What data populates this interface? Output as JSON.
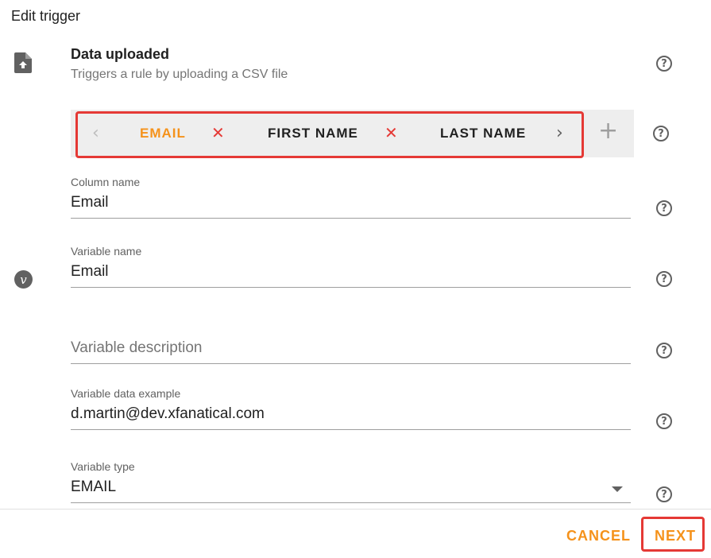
{
  "dialog": {
    "title": "Edit trigger"
  },
  "trigger": {
    "icon": "file-upload-icon",
    "title": "Data uploaded",
    "description": "Triggers a rule by uploading a CSV file"
  },
  "tabs": {
    "items": [
      {
        "label": "EMAIL",
        "active": true
      },
      {
        "label": "FIRST NAME",
        "active": false
      },
      {
        "label": "LAST NAME",
        "active": false
      }
    ],
    "remove_symbol": "✕",
    "add_symbol": "+",
    "prev_symbol": "‹",
    "next_symbol": "›"
  },
  "fields": {
    "column_name": {
      "label": "Column name",
      "value": "Email"
    },
    "variable_name": {
      "label": "Variable name",
      "value": "Email"
    },
    "variable_description": {
      "placeholder": "Variable description"
    },
    "variable_data_example": {
      "label": "Variable data example",
      "value": "d.martin@dev.xfanatical.com"
    },
    "variable_type": {
      "label": "Variable type",
      "value": "EMAIL"
    }
  },
  "help_symbol": "?",
  "variable_icon_symbol": "v",
  "actions": {
    "cancel": "CANCEL",
    "next": "NEXT"
  },
  "colors": {
    "accent": "#f5921b",
    "highlight": "#e53935",
    "remove": "#e53935"
  }
}
